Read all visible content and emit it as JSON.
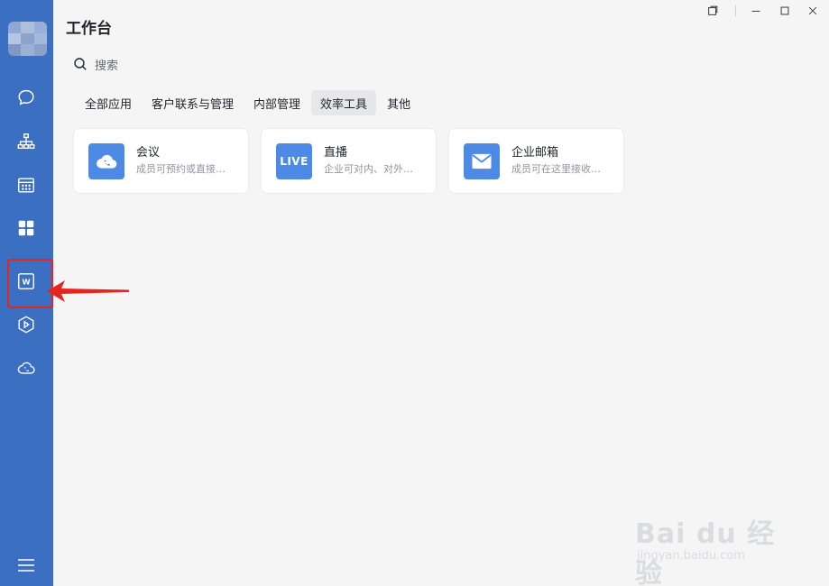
{
  "sidebar": {
    "icons": [
      "chat-icon",
      "org-chart-icon",
      "calendar-icon",
      "workbench-icon",
      "docs-icon",
      "box-icon",
      "cloud-phone-icon",
      "menu-icon"
    ]
  },
  "header": {
    "title": "工作台"
  },
  "search": {
    "placeholder": "搜索"
  },
  "tabs": [
    {
      "label": "全部应用",
      "active": false
    },
    {
      "label": "客户联系与管理",
      "active": false
    },
    {
      "label": "内部管理",
      "active": false
    },
    {
      "label": "效率工具",
      "active": true
    },
    {
      "label": "其他",
      "active": false
    }
  ],
  "apps": [
    {
      "name": "会议",
      "desc": "成员可预约或直接发起会议",
      "icon": "cloud-phone-icon"
    },
    {
      "name": "直播",
      "desc": "企业可对内、对外进行直播",
      "icon": "live-icon",
      "icon_text": "LIVE"
    },
    {
      "name": "企业邮箱",
      "desc": "成员可在这里接收和发送邮件",
      "icon": "mail-icon"
    }
  ],
  "watermark": {
    "main": "Bai du 经验",
    "sub": "jingyan.baidu.com"
  },
  "colors": {
    "sidebar": "#3a6fc1",
    "accent": "#4d8ae6",
    "highlight": "#e8241f",
    "background": "#f5f5f6"
  }
}
